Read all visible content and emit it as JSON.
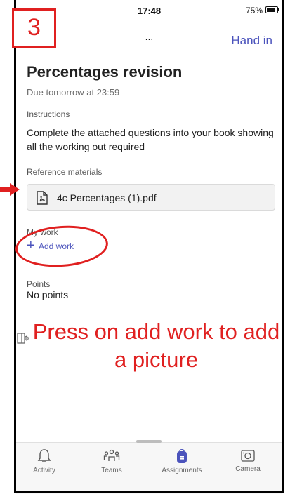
{
  "status_bar": {
    "time": "17:48",
    "battery": "75%"
  },
  "nav": {
    "more": "...",
    "hand_in": "Hand in"
  },
  "assignment": {
    "title": "Percentages revision",
    "due": "Due tomorrow at 23:59",
    "instructions_label": "Instructions",
    "instructions": "Complete the attached questions into your book showing all the working out required",
    "reference_label": "Reference materials",
    "file_name": "4c Percentages (1).pdf",
    "my_work_label": "My work",
    "add_work": "Add work",
    "points_label": "Points",
    "points_value": "No points"
  },
  "tabs": [
    {
      "label": "Activity",
      "icon": "bell-icon"
    },
    {
      "label": "Teams",
      "icon": "teams-icon"
    },
    {
      "label": "Assignments",
      "icon": "assignments-icon",
      "active": true
    },
    {
      "label": "Camera",
      "icon": "camera-icon"
    }
  ],
  "overlay": {
    "step_number": "3",
    "instruction": "Press on add work to add a picture",
    "color": "#e02020"
  },
  "colors": {
    "accent": "#4b53bc",
    "annotation": "#e02020"
  }
}
